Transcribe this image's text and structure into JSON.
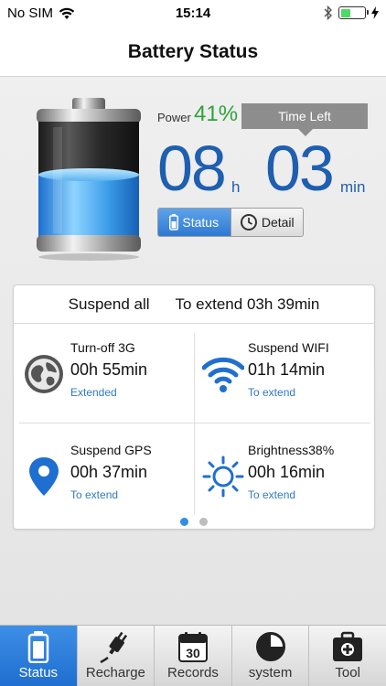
{
  "status_bar": {
    "carrier": "No SIM",
    "time": "15:14"
  },
  "nav": {
    "title": "Battery Status"
  },
  "battery": {
    "power_label": "Power",
    "power_value": "41%",
    "time_left_label": "Time Left",
    "hours": "08",
    "hours_unit": "h",
    "minutes": "03",
    "minutes_unit": "min",
    "segment": {
      "status_label": "Status",
      "detail_label": "Detail"
    }
  },
  "suspend": {
    "header_left": "Suspend all",
    "header_right": "To extend 03h 39min",
    "items": [
      {
        "title": "Turn-off 3G",
        "time": "00h 55min",
        "action": "Extended",
        "icon": "globe-icon"
      },
      {
        "title": "Suspend WIFI",
        "time": "01h 14min",
        "action": "To extend",
        "icon": "wifi-icon"
      },
      {
        "title": "Suspend GPS",
        "time": "00h 37min",
        "action": "To extend",
        "icon": "location-pin-icon"
      },
      {
        "title": "Brightness38%",
        "time": "00h 16min",
        "action": "To extend",
        "icon": "sun-icon"
      }
    ],
    "page_indicator": {
      "count": 2,
      "current": 1
    }
  },
  "tabs": [
    {
      "label": "Status",
      "icon": "battery-icon",
      "active": true
    },
    {
      "label": "Recharge",
      "icon": "plug-icon",
      "active": false
    },
    {
      "label": "Records",
      "icon": "calendar-icon",
      "active": false
    },
    {
      "label": "system",
      "icon": "pie-chart-icon",
      "active": false
    },
    {
      "label": "Tool",
      "icon": "toolbox-icon",
      "active": false
    }
  ],
  "colors": {
    "accent_blue": "#1f5fb0",
    "power_green": "#2fa33a",
    "link_blue": "#2f79c8",
    "tab_active": "#2f79d2"
  }
}
